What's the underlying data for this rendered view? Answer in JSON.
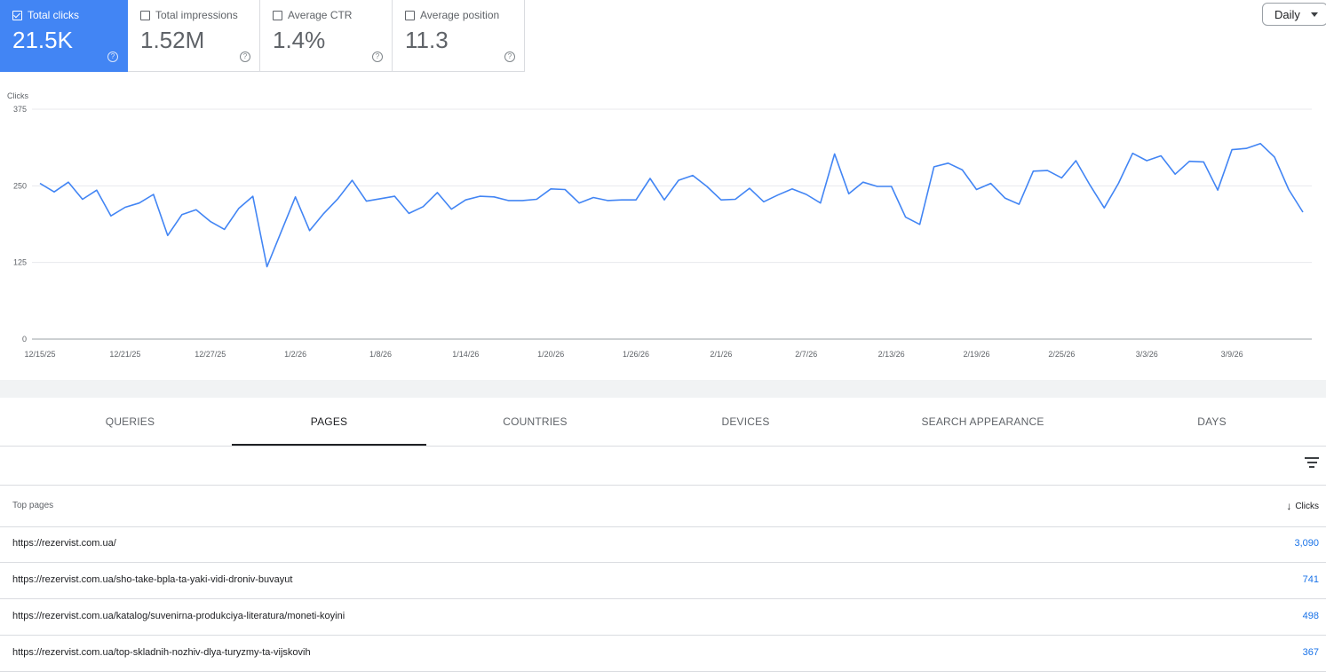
{
  "metrics": [
    {
      "label": "Total clicks",
      "value": "21.5K",
      "active": true
    },
    {
      "label": "Total impressions",
      "value": "1.52M",
      "active": false
    },
    {
      "label": "Average CTR",
      "value": "1.4%",
      "active": false
    },
    {
      "label": "Average position",
      "value": "11.3",
      "active": false
    }
  ],
  "period_select": "Daily",
  "colors": {
    "accent": "#4285f4",
    "line": "#4285f4",
    "link": "#1a73e8"
  },
  "chart_data": {
    "type": "line",
    "ylabel": "Clicks",
    "ylim": [
      0,
      375
    ],
    "yticks": [
      0,
      125,
      250,
      375
    ],
    "grid": true,
    "x_start": "12/15/25",
    "xtick_labels": [
      "12/15/25",
      "12/21/25",
      "12/27/25",
      "1/2/26",
      "1/8/26",
      "1/14/26",
      "1/20/26",
      "1/26/26",
      "2/1/26",
      "2/7/26",
      "2/13/26",
      "2/19/26",
      "2/25/26",
      "3/3/26",
      "3/9/26"
    ],
    "series": [
      {
        "values": [
          254,
          240,
          256,
          228,
          243,
          201,
          215,
          222,
          236,
          169,
          203,
          211,
          192,
          179,
          213,
          233,
          118,
          175,
          232,
          177,
          205,
          229,
          259,
          225,
          229,
          233,
          205,
          216,
          239,
          212,
          227,
          233,
          232,
          226,
          226,
          228,
          245,
          244,
          222,
          231,
          226,
          227,
          227,
          262,
          227,
          259,
          267,
          249,
          227,
          228,
          246,
          224,
          235,
          245,
          236,
          222,
          302,
          237,
          256,
          249,
          249,
          199,
          187,
          281,
          287,
          276,
          244,
          254,
          230,
          220,
          274,
          275,
          263,
          291,
          251,
          214,
          254,
          303,
          291,
          299,
          269,
          290,
          289,
          243,
          309,
          311,
          319,
          297,
          244,
          207
        ]
      }
    ]
  },
  "tabs": [
    "QUERIES",
    "PAGES",
    "COUNTRIES",
    "DEVICES",
    "SEARCH APPEARANCE",
    "DAYS"
  ],
  "active_tab": "PAGES",
  "table": {
    "column_label": "Top pages",
    "sort_column": "Clicks",
    "rows": [
      {
        "url": "https://rezervist.com.ua/",
        "clicks": "3,090"
      },
      {
        "url": "https://rezervist.com.ua/sho-take-bpla-ta-yaki-vidi-droniv-buvayut",
        "clicks": "741"
      },
      {
        "url": "https://rezervist.com.ua/katalog/suvenirna-produkciya-literatura/moneti-koyini",
        "clicks": "498"
      },
      {
        "url": "https://rezervist.com.ua/top-skladnih-nozhiv-dlya-turyzmy-ta-vijskovih",
        "clicks": "367"
      }
    ]
  }
}
